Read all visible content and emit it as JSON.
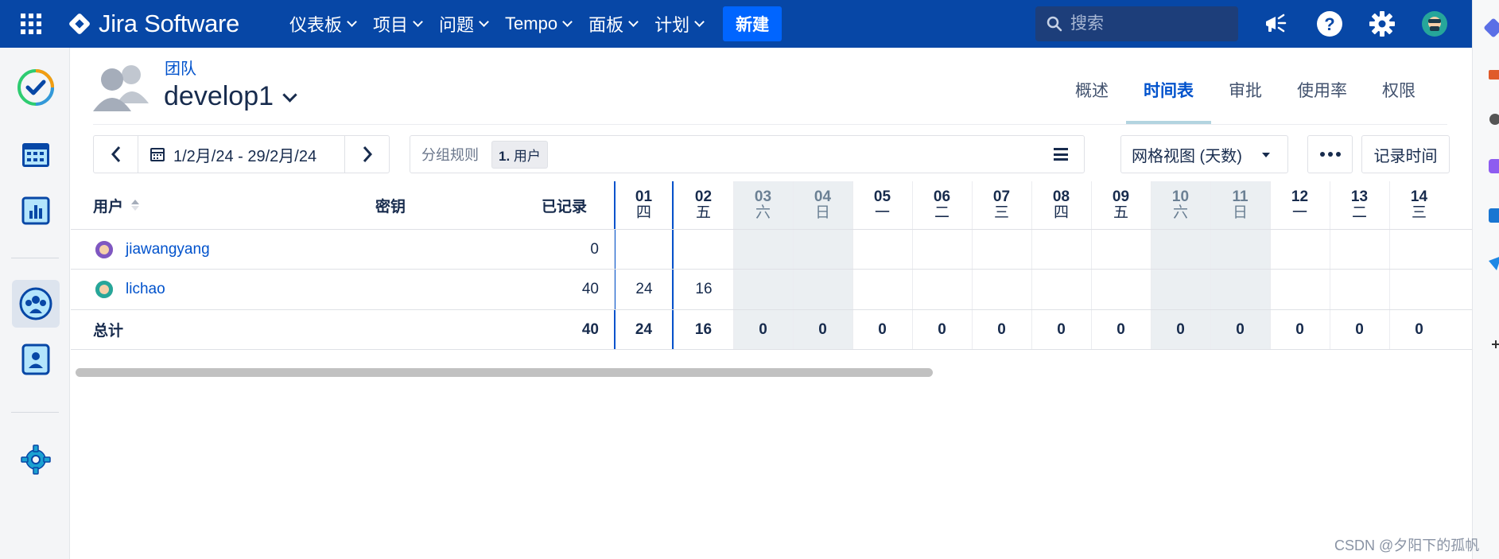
{
  "topnav": {
    "product": "Jira Software",
    "items": [
      {
        "label": "仪表板"
      },
      {
        "label": "项目"
      },
      {
        "label": "问题"
      },
      {
        "label": "Tempo"
      },
      {
        "label": "面板"
      },
      {
        "label": "计划"
      }
    ],
    "create_label": "新建",
    "search_placeholder": "搜索"
  },
  "header": {
    "breadcrumb": "团队",
    "team_name": "develop1"
  },
  "tabs": [
    {
      "label": "概述",
      "active": false
    },
    {
      "label": "时间表",
      "active": true
    },
    {
      "label": "审批",
      "active": false
    },
    {
      "label": "使用率",
      "active": false
    },
    {
      "label": "权限",
      "active": false
    }
  ],
  "toolbar": {
    "date_range": "1/2月/24 - 29/2月/24",
    "grouping_label": "分组规则",
    "grouping_chip_num": "1.",
    "grouping_chip_text": "用户",
    "view_label": "网格视图 (天数)",
    "log_time_label": "记录时间"
  },
  "table": {
    "col_user": "用户",
    "col_key": "密钥",
    "col_logged": "已记录",
    "days": [
      {
        "day": "01",
        "dow": "四",
        "weekend": false
      },
      {
        "day": "02",
        "dow": "五",
        "weekend": false
      },
      {
        "day": "03",
        "dow": "六",
        "weekend": true
      },
      {
        "day": "04",
        "dow": "日",
        "weekend": true
      },
      {
        "day": "05",
        "dow": "一",
        "weekend": false
      },
      {
        "day": "06",
        "dow": "二",
        "weekend": false
      },
      {
        "day": "07",
        "dow": "三",
        "weekend": false
      },
      {
        "day": "08",
        "dow": "四",
        "weekend": false
      },
      {
        "day": "09",
        "dow": "五",
        "weekend": false
      },
      {
        "day": "10",
        "dow": "六",
        "weekend": true
      },
      {
        "day": "11",
        "dow": "日",
        "weekend": true
      },
      {
        "day": "12",
        "dow": "一",
        "weekend": false
      },
      {
        "day": "13",
        "dow": "二",
        "weekend": false
      },
      {
        "day": "14",
        "dow": "三",
        "weekend": false
      }
    ],
    "rows": [
      {
        "user": "jiawangyang",
        "avatar_color": "#7e57c2",
        "logged": "0",
        "cells": [
          "",
          "",
          "",
          "",
          "",
          "",
          "",
          "",
          "",
          "",
          "",
          "",
          "",
          ""
        ]
      },
      {
        "user": "lichao",
        "avatar_color": "#26a69a",
        "logged": "40",
        "cells": [
          "24",
          "16",
          "",
          "",
          "",
          "",
          "",
          "",
          "",
          "",
          "",
          "",
          "",
          ""
        ]
      }
    ],
    "total_label": "总计",
    "total_logged": "40",
    "totals": [
      "24",
      "16",
      "0",
      "0",
      "0",
      "0",
      "0",
      "0",
      "0",
      "0",
      "0",
      "0",
      "0",
      "0"
    ]
  },
  "watermark": "CSDN @夕阳下的孤帆",
  "colors": {
    "topbar": "#0747a6",
    "create": "#0065ff",
    "link": "#0052cc",
    "weekend": "#ebeff2"
  }
}
